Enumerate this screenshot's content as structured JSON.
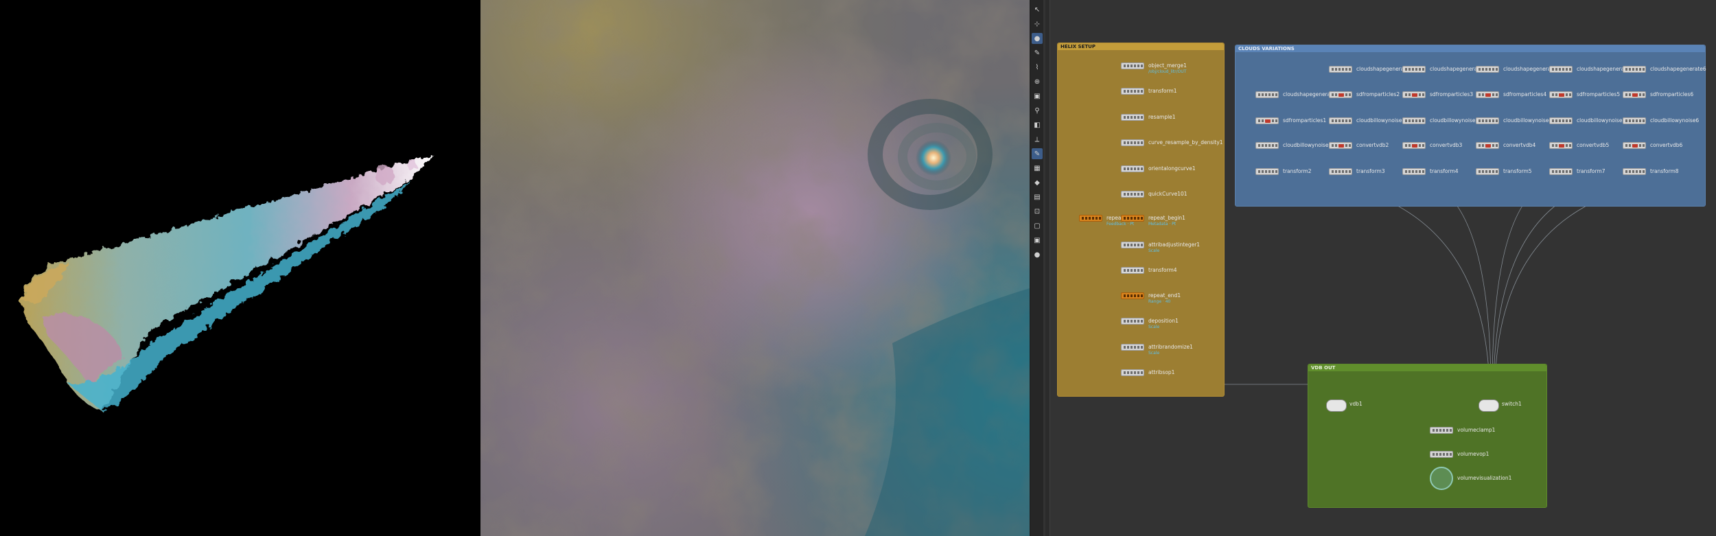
{
  "network": {
    "helix_setup": {
      "title": "HELIX SETUP",
      "nodes": [
        {
          "label": "object_merge1",
          "sub": "/obj/cloud_litr/OUT"
        },
        {
          "label": "transform1",
          "sub": ""
        },
        {
          "label": "resample1",
          "sub": ""
        },
        {
          "label": "curve_resample_by_density1",
          "sub": ""
        },
        {
          "label": "orientalongcurve1",
          "sub": ""
        },
        {
          "label": "quickCurve101",
          "sub": ""
        },
        {
          "label": "repeat_begin1",
          "sub": "Feedback · Pt",
          "color": "orange"
        },
        {
          "label": "repeat_begin1",
          "sub": "Metadata · Pt",
          "color": "orange"
        },
        {
          "label": "attribadjustinteger1",
          "sub": "Scale"
        },
        {
          "label": "transform4",
          "sub": ""
        },
        {
          "label": "repeat_end1",
          "sub": "Range · 40",
          "color": "orange"
        },
        {
          "label": "deposition1",
          "sub": "Scale"
        },
        {
          "label": "attribrandomize1",
          "sub": "Scale"
        },
        {
          "label": "attribsop1",
          "sub": ""
        }
      ]
    },
    "clouds_variations": {
      "title": "CLOUDS VARIATIONS",
      "row1": [
        "cloudshapegenerate2",
        "cloudshapegenerate3",
        "cloudshapegenerate4",
        "cloudshapegenerate5",
        "cloudshapegenerate6"
      ],
      "row1b": [
        "cloudshapegenerate1",
        "sdfromparticles2",
        "sdfromparticles3",
        "sdfromparticles4",
        "sdfromparticles5",
        "sdfromparticles6"
      ],
      "row2": [
        "sdfromparticles1",
        "cloudbillowynoise2",
        "cloudbillowynoise3",
        "cloudbillowynoise4",
        "cloudbillowynoise5",
        "cloudbillowynoise6"
      ],
      "row3": [
        "cloudbillowynoise1",
        "convertvdb2",
        "convertvdb3",
        "convertvdb4",
        "convertvdb5",
        "convertvdb6"
      ],
      "row4": [
        "transform2",
        "transform3",
        "transform4",
        "transform5",
        "transform7",
        "transform8"
      ]
    },
    "vdb_out": {
      "title": "VDB OUT",
      "vdb_label": "vdb1",
      "switch_label": "switch1",
      "volumeclamp_label": "volumeclamp1",
      "volumevop_label": "volumevop1",
      "viz_label": "volumevisualization1"
    }
  },
  "toolbar": {
    "icons": [
      "select-icon",
      "select-mode-icon",
      "pose-icon",
      "handle-icon",
      "brush-icon",
      "view-icon",
      "snap-icon",
      "paint-icon",
      "camera-icon",
      "ruler-icon",
      "pen-icon",
      "grid-icon",
      "shading-icon",
      "uv-icon",
      "node-icon",
      "box-icon",
      "display-icon",
      "light-icon"
    ]
  },
  "colors": {
    "helix_box": "#9c7e32",
    "clouds_box": "#4d6f97",
    "vdb_box": "#4f7326",
    "network_bg": "#333333",
    "cloud_cyan": "#4fb4cc",
    "cloud_pink": "#c69cb4",
    "cloud_gold": "#b8a25a"
  }
}
